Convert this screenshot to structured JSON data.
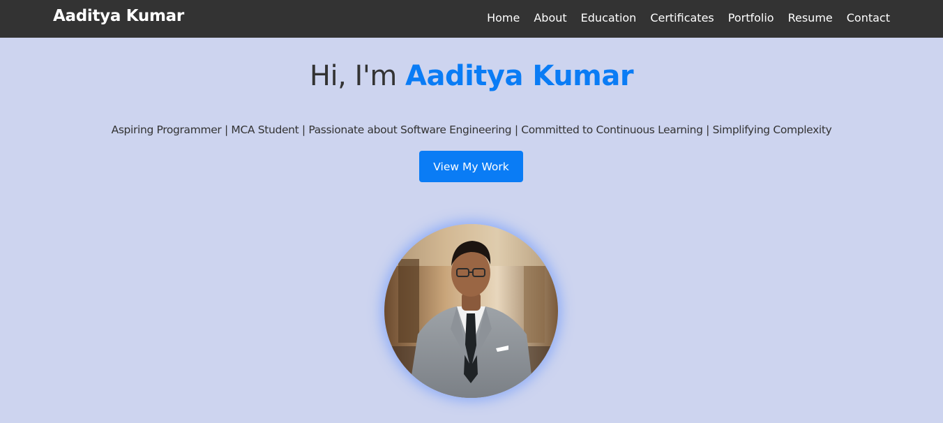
{
  "nav": {
    "brand": "Aaditya Kumar",
    "links": [
      "Home",
      "About",
      "Education",
      "Certificates",
      "Portfolio",
      "Resume",
      "Contact"
    ]
  },
  "hero": {
    "greeting": "Hi, I'm ",
    "name": "Aaditya Kumar",
    "tagline": "Aspiring Programmer | MCA Student | Passionate about Software Engineering | Committed to Continuous Learning | Simplifying Complexity",
    "cta_label": "View My Work"
  },
  "colors": {
    "background": "#cdd4ef",
    "navbar": "#333333",
    "accent": "#0a7cf5",
    "text": "#333333"
  }
}
